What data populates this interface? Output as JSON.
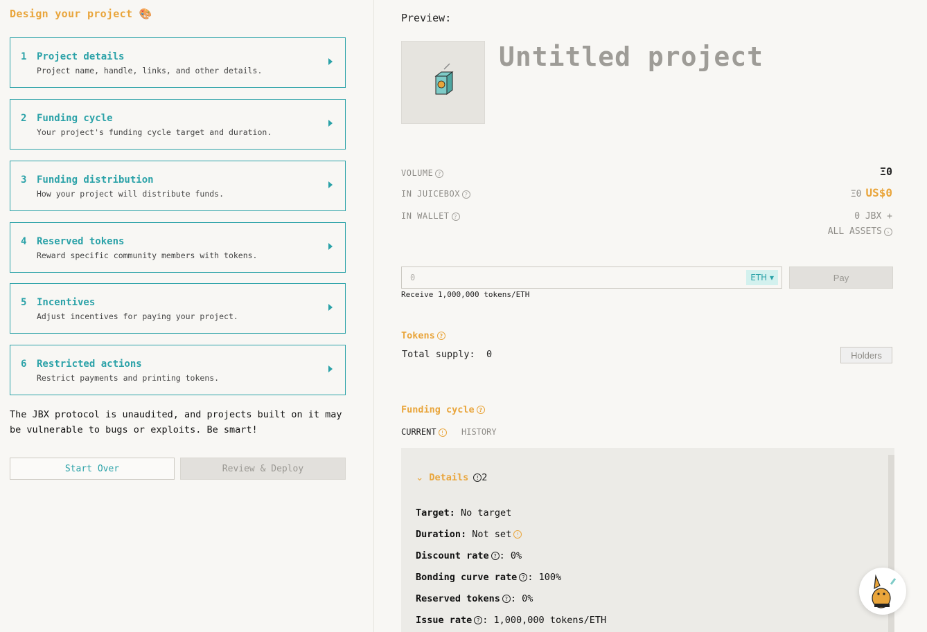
{
  "left": {
    "title": "Design your project",
    "title_emoji": "🎨",
    "steps": [
      {
        "num": "1",
        "title": "Project details",
        "desc": "Project name, handle, links, and other details."
      },
      {
        "num": "2",
        "title": "Funding cycle",
        "desc": "Your project's funding cycle target and duration."
      },
      {
        "num": "3",
        "title": "Funding distribution",
        "desc": "How your project will distribute funds."
      },
      {
        "num": "4",
        "title": "Reserved tokens",
        "desc": "Reward specific community members with tokens."
      },
      {
        "num": "5",
        "title": "Incentives",
        "desc": "Adjust incentives for paying your project."
      },
      {
        "num": "6",
        "title": "Restricted actions",
        "desc": "Restrict payments and printing tokens."
      }
    ],
    "warning": "The JBX protocol is unaudited, and projects built on it may be vulnerable to bugs or exploits. Be smart!",
    "start_over": "Start Over",
    "review_deploy": "Review & Deploy"
  },
  "preview": {
    "label": "Preview:",
    "project_name": "Untitled project",
    "volume_label": "VOLUME",
    "volume_value": "Ξ0",
    "in_juicebox_label": "IN JUICEBOX",
    "in_juicebox_eth": "Ξ0",
    "in_juicebox_usd": "US$0",
    "in_wallet_label": "IN WALLET",
    "in_wallet_value": "0 JBX +",
    "all_assets": "ALL ASSETS",
    "pay_placeholder": "0",
    "currency": "ETH",
    "pay_button": "Pay",
    "receive_text": "Receive 1,000,000 tokens/ETH",
    "tokens_title": "Tokens",
    "total_supply_label": "Total supply:",
    "total_supply_value": "0",
    "holders_button": "Holders",
    "funding_cycle_title": "Funding cycle",
    "tab_current": "CURRENT",
    "tab_history": "HISTORY",
    "details_label": "Details",
    "details_count": "2",
    "target_label": "Target:",
    "target_value": "No target",
    "duration_label": "Duration:",
    "duration_value": "Not set",
    "discount_label": "Discount rate",
    "discount_value": ": 0%",
    "bonding_label": "Bonding curve rate",
    "bonding_value": ": 100%",
    "reserved_label": "Reserved tokens",
    "reserved_value": ": 0%",
    "issue_label": "Issue rate",
    "issue_value": ": 1,000,000 tokens/ETH"
  },
  "colors": {
    "accent_teal": "#2ba2a8",
    "accent_orange": "#e9a53b",
    "background": "#f8f7f4"
  }
}
